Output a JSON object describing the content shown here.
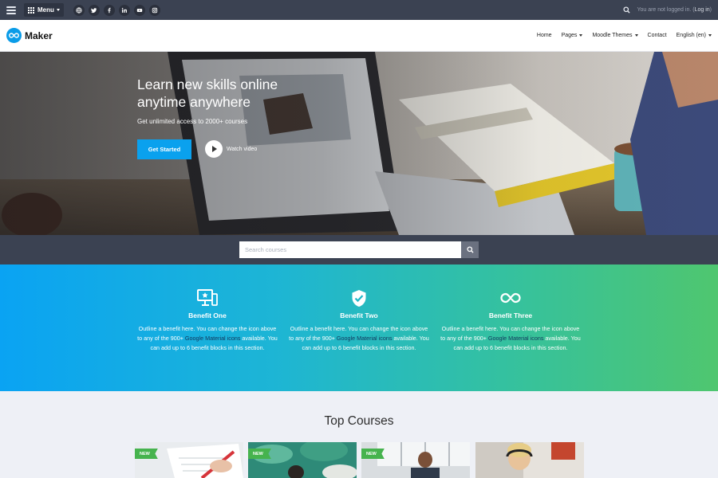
{
  "topbar": {
    "menu_label": "Menu",
    "social_icons": [
      "globe-icon",
      "twitter-icon",
      "facebook-icon",
      "linkedin-icon",
      "youtube-icon",
      "instagram-icon"
    ],
    "login_status": "You are not logged in. (",
    "login_link": "Log in",
    "login_close": ")"
  },
  "navbar": {
    "logo_text": "Maker",
    "items": [
      {
        "label": "Home",
        "dropdown": false
      },
      {
        "label": "Pages",
        "dropdown": true
      },
      {
        "label": "Moodle Themes",
        "dropdown": true
      },
      {
        "label": "Contact",
        "dropdown": false
      },
      {
        "label": "English (en)",
        "dropdown": true
      }
    ]
  },
  "hero": {
    "title_line1": "Learn new skills online",
    "title_line2": "anytime anywhere",
    "subtitle": "Get unlimited access to 2000+ courses",
    "cta_label": "Get Started",
    "video_label": "Watch video"
  },
  "search": {
    "placeholder": "Search courses"
  },
  "benefits": [
    {
      "icon": "monitor-star-icon",
      "title": "Benefit One",
      "text_before": "Outline a benefit here. You can change the icon above to any of the 900+ ",
      "link": "Google Material icons",
      "text_after": " available. You can add up to 6 benefit blocks in this section."
    },
    {
      "icon": "shield-check-icon",
      "title": "Benefit Two",
      "text_before": "Outline a benefit here. You can change the icon above to any of the 900+ ",
      "link": "Google Material icons",
      "text_after": " available. You can add up to 6 benefit blocks in this section."
    },
    {
      "icon": "infinity-icon",
      "title": "Benefit Three",
      "text_before": "Outline a benefit here. You can change the icon above to any of the 900+ ",
      "link": "Google Material icons",
      "text_after": " available. You can add up to 6 benefit blocks in this section."
    }
  ],
  "courses": {
    "heading": "Top Courses",
    "cards": [
      {
        "badge": "NEW"
      },
      {
        "badge": "NEW"
      },
      {
        "badge": "NEW"
      },
      {
        "badge": ""
      }
    ]
  },
  "colors": {
    "topbar": "#3b4252",
    "accent": "#0aa1ee",
    "badge": "#46b34e"
  }
}
